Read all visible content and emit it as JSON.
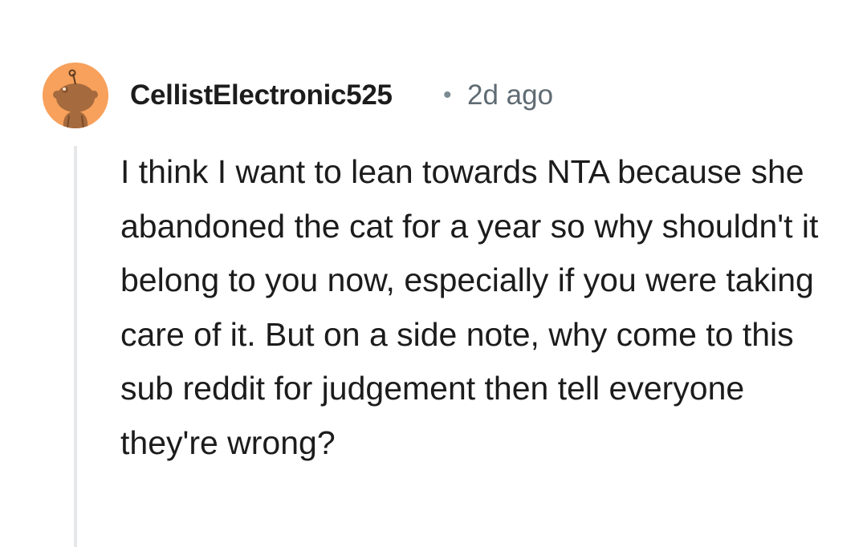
{
  "comment": {
    "avatar_icon": "reddit-snoo-avatar-icon",
    "avatar_color": "#f7a15c",
    "username": "CellistElectronic525",
    "separator": "•",
    "timestamp": "2d ago",
    "body": "I think I want to lean towards NTA because she abandoned the cat for a year so why shouldn't it belong to you now, especially if you were taking care of it. But on a side note, why come to this sub reddit for judgement then tell everyone they're wrong?"
  }
}
